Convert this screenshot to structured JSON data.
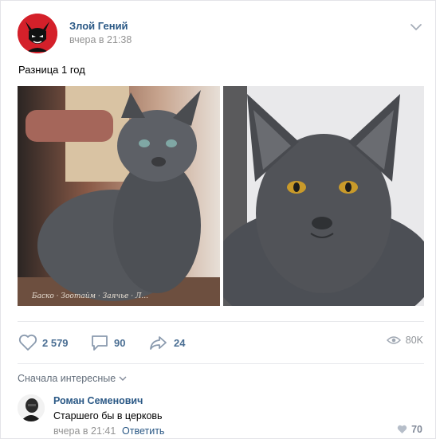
{
  "post": {
    "author": "Злой Гений",
    "time": "вчера в 21:38",
    "text": "Разница 1 год",
    "photo_watermark": "Баско · Зоотайм · Заячье · Л..."
  },
  "actions": {
    "likes": "2 579",
    "comments": "90",
    "shares": "24",
    "views": "80K"
  },
  "comments": {
    "sort_label": "Сначала интересные",
    "items": [
      {
        "author": "Роман Семенович",
        "text": "Старшего бы в церковь",
        "time": "вчера в 21:41",
        "reply_label": "Ответить",
        "likes": "70"
      }
    ]
  },
  "colors": {
    "link": "#2a5885",
    "accent_red": "#d4202a",
    "muted": "#939393"
  },
  "icons": [
    "devil-avatar-icon",
    "chevron-down-icon",
    "heart-icon",
    "comment-icon",
    "share-icon",
    "eye-icon"
  ]
}
